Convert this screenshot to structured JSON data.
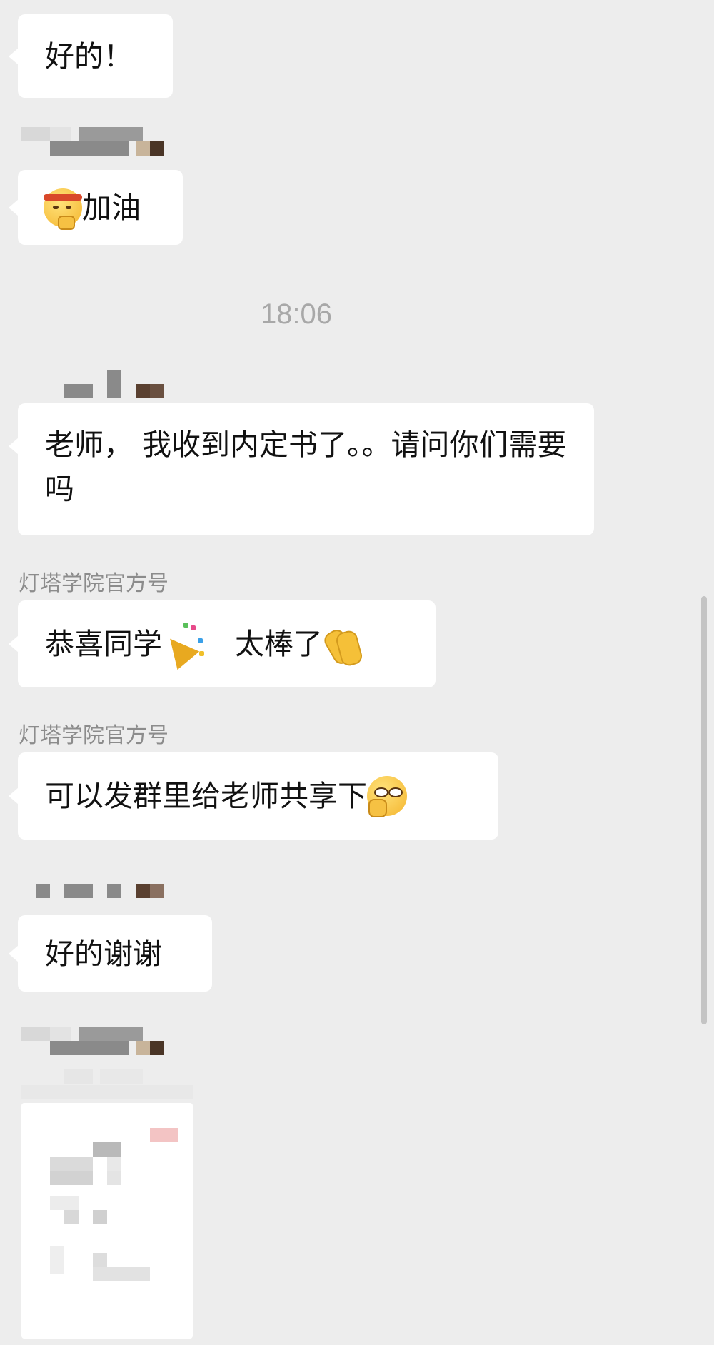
{
  "messages": [
    {
      "text": "好的！"
    },
    {
      "text": "加油",
      "emoji": "headband-face-emoji"
    },
    {
      "text": "老师， 我收到内定书了。。请问你们需要吗"
    },
    {
      "sender": "灯塔学院官方号",
      "text_a": "恭喜同学",
      "text_b": "太棒了",
      "emojis": [
        "party-popper-emoji",
        "clapping-hands-emoji"
      ]
    },
    {
      "sender": "灯塔学院官方号",
      "text": "可以发群里给老师共享下",
      "emoji": "smirking-face-emoji"
    },
    {
      "text": "好的谢谢"
    }
  ],
  "timestamp": "18:06",
  "colors": {
    "background": "#ededed",
    "bubble": "#ffffff",
    "sender_name": "#8c8c8c",
    "timestamp": "#a8a8a8"
  }
}
